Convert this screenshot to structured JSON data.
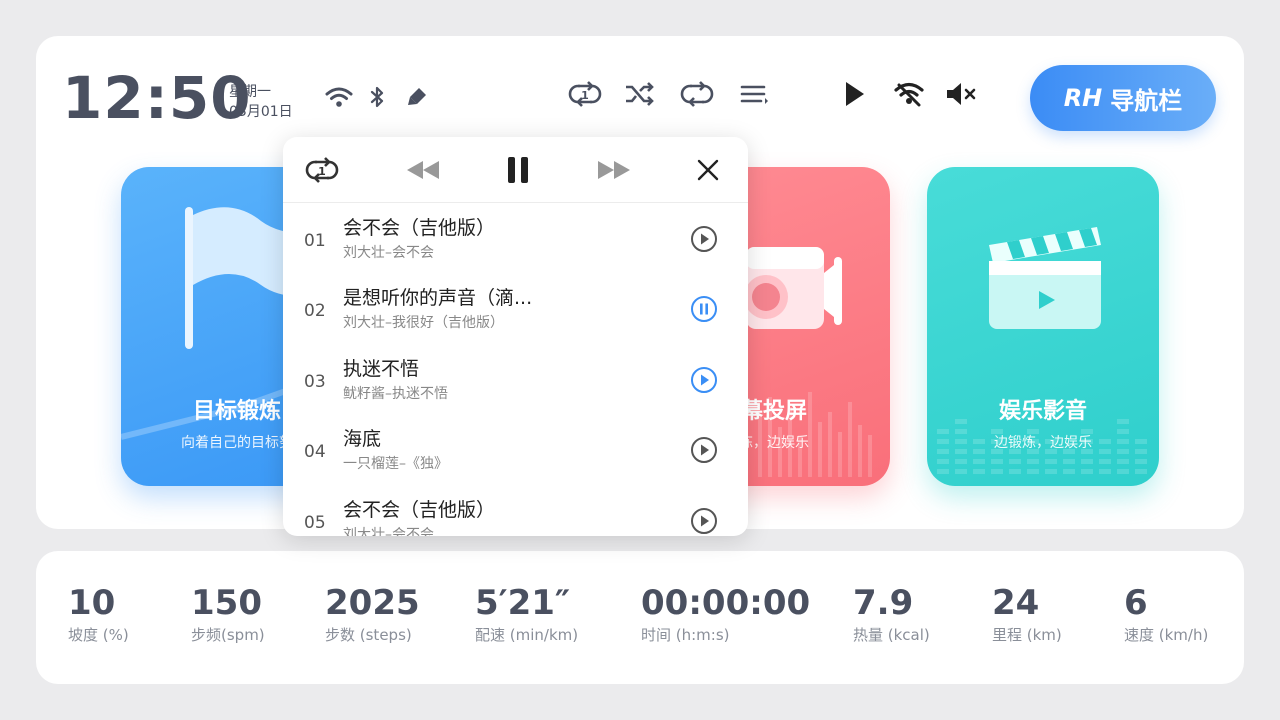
{
  "status_bar": {
    "time": "12:50",
    "weekday": "星期一",
    "date": "03月01日",
    "icons": [
      "wifi-icon",
      "bluetooth-icon",
      "brush-icon"
    ]
  },
  "controls": [
    "repeat-one-icon",
    "shuffle-icon",
    "repeat-icon",
    "playlist-icon",
    "play-icon",
    "wifi-off-icon",
    "mute-icon"
  ],
  "nav_button": {
    "prefix": "RH",
    "label": "导航栏"
  },
  "cards": [
    {
      "title": "目标锻炼",
      "subtitle": "向着自己的目标努",
      "color": "#3a98f6"
    },
    {
      "title": "幕投屏",
      "subtitle": "炼，边娱乐",
      "color": "#f96f7a"
    },
    {
      "title": "娱乐影音",
      "subtitle": "边锻炼，边娱乐",
      "color": "#2fcfcc"
    }
  ],
  "music_popup": {
    "toolbar": [
      "repeat-one-icon",
      "rewind-icon",
      "pause-icon",
      "fast-forward-icon",
      "close-icon"
    ],
    "tracks": [
      {
        "num": "01",
        "title": "会不会（吉他版）",
        "artist": "刘大壮–会不会",
        "state": "play"
      },
      {
        "num": "02",
        "title": "是想听你的声音（滴...",
        "artist": "刘大壮–我很好（吉他版）",
        "state": "pause"
      },
      {
        "num": "03",
        "title": "执迷不悟",
        "artist": "鱿籽酱–执迷不悟",
        "state": "play-active"
      },
      {
        "num": "04",
        "title": "海底",
        "artist": "一只榴莲–《独》",
        "state": "play"
      },
      {
        "num": "05",
        "title": "会不会（吉他版）",
        "artist": "刘大壮–会不会",
        "state": "play"
      }
    ]
  },
  "stats": [
    {
      "value": "10",
      "label": "坡度 (%)"
    },
    {
      "value": "150",
      "label": "步频(spm)"
    },
    {
      "value": "2025",
      "label": "步数 (steps)"
    },
    {
      "value": "5′21″",
      "label": "配速 (min/km)"
    },
    {
      "value": "00:00:00",
      "label": "时间 (h:m:s)"
    },
    {
      "value": "7.9",
      "label": "热量 (kcal)"
    },
    {
      "value": "24",
      "label": "里程 (km)"
    },
    {
      "value": "6",
      "label": "速度 (km/h)"
    }
  ],
  "colors": {
    "accent_blue": "#3a8ef5",
    "text_dark": "#4a5060",
    "text_muted": "#8a8f99"
  }
}
